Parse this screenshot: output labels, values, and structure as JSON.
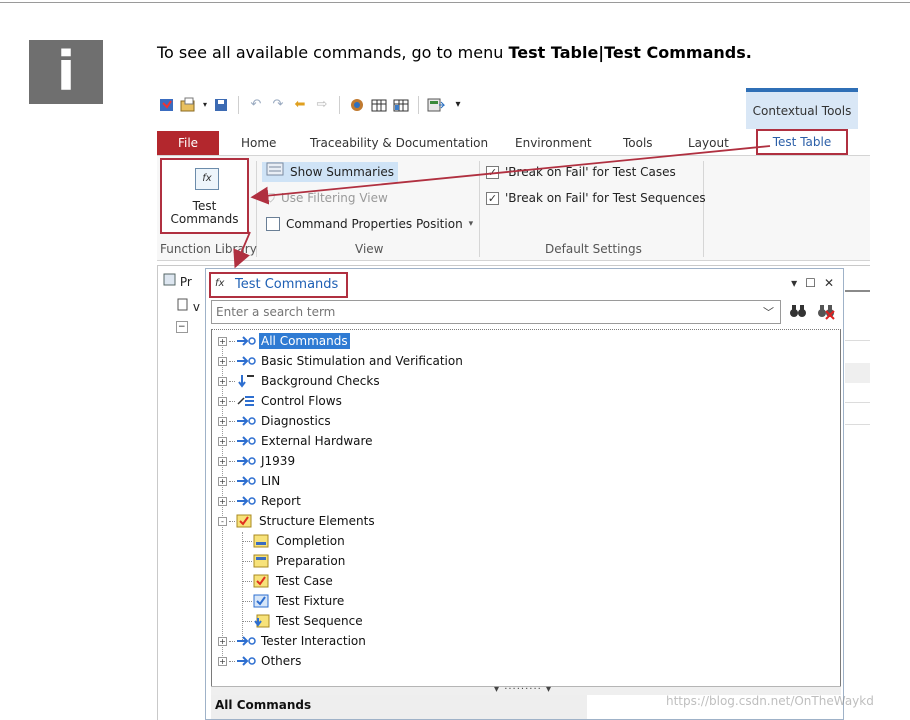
{
  "intro": {
    "prefix": "To see all available commands, go to menu ",
    "bold": "Test Table|Test Commands."
  },
  "info_icon": "info-icon",
  "quick_access": {
    "icons": [
      "test-file-icon",
      "open-folder-icon",
      "save-icon",
      "undo-icon",
      "redo-icon",
      "back-icon",
      "forward-icon",
      "settings-icon",
      "grid-icon",
      "grid-alt-icon",
      "export-icon",
      "dropdown-icon"
    ]
  },
  "ribbon": {
    "contextual_header": "Contextual Tools",
    "tabs": [
      "File",
      "Home",
      "Traceability & Documentation",
      "Environment",
      "Tools",
      "Layout",
      "Test Table"
    ],
    "test_commands_label_1": "Test",
    "test_commands_label_2": "Commands",
    "fx_glyph": "fx",
    "show_summaries": "Show Summaries",
    "use_filtering_view": "Use Filtering View",
    "command_properties_position": "Command Properties Position",
    "break_on_fail_cases": "'Break on Fail' for Test Cases",
    "break_on_fail_sequences": "'Break on Fail' for Test Sequences",
    "group_function_library": "Function Library",
    "group_view": "View",
    "group_default_settings": "Default Settings"
  },
  "background": {
    "tab_label": "Pr",
    "row_label": "v"
  },
  "dialog": {
    "title": "Test Commands",
    "search_placeholder": "Enter a search term",
    "tree": [
      {
        "label": "All Commands",
        "icon": "arrow-icon",
        "toggle": "+",
        "depth": 0,
        "selected": true
      },
      {
        "label": "Basic Stimulation and Verification",
        "icon": "arrow-icon",
        "toggle": "+",
        "depth": 0
      },
      {
        "label": "Background Checks",
        "icon": "background-check-icon",
        "toggle": "+",
        "depth": 0
      },
      {
        "label": "Control Flows",
        "icon": "control-flow-icon",
        "toggle": "+",
        "depth": 0
      },
      {
        "label": "Diagnostics",
        "icon": "arrow-icon",
        "toggle": "+",
        "depth": 0
      },
      {
        "label": "External Hardware",
        "icon": "arrow-icon",
        "toggle": "+",
        "depth": 0
      },
      {
        "label": "J1939",
        "icon": "arrow-icon",
        "toggle": "+",
        "depth": 0
      },
      {
        "label": "LIN",
        "icon": "arrow-icon",
        "toggle": "+",
        "depth": 0
      },
      {
        "label": "Report",
        "icon": "arrow-icon",
        "toggle": "+",
        "depth": 0
      },
      {
        "label": "Structure Elements",
        "icon": "structure-icon",
        "toggle": "-",
        "depth": 0
      },
      {
        "label": "Completion",
        "icon": "completion-icon",
        "toggle": "",
        "depth": 1
      },
      {
        "label": "Preparation",
        "icon": "preparation-icon",
        "toggle": "",
        "depth": 1
      },
      {
        "label": "Test Case",
        "icon": "test-case-icon",
        "toggle": "",
        "depth": 1
      },
      {
        "label": "Test Fixture",
        "icon": "test-fixture-icon",
        "toggle": "",
        "depth": 1
      },
      {
        "label": "Test Sequence",
        "icon": "test-sequence-icon",
        "toggle": "",
        "depth": 1
      },
      {
        "label": "Tester Interaction",
        "icon": "arrow-icon",
        "toggle": "+",
        "depth": 0
      },
      {
        "label": "Others",
        "icon": "arrow-icon",
        "toggle": "+",
        "depth": 0
      }
    ],
    "description_title": "All Commands"
  },
  "watermark": "https://blog.csdn.net/OnTheWaykd",
  "colors": {
    "file_tab": "#b3272d",
    "highlight_box": "#b03040",
    "contextual_band": "#2f6fb6",
    "selection": "#2f7bd3",
    "dialog_title": "#1d5fb4"
  }
}
